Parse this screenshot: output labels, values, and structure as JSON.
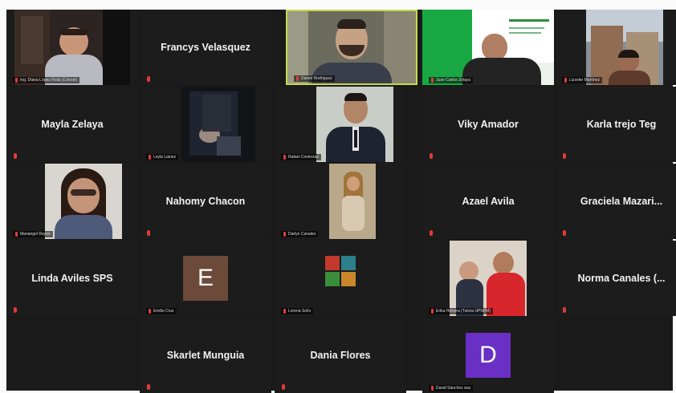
{
  "participants": [
    {
      "display": "label",
      "name": "Ing. Diana López Rolla (Cohost)"
    },
    {
      "display": "name",
      "name": "Francys Velasquez"
    },
    {
      "display": "label",
      "name": "Daniel Rodríguez"
    },
    {
      "display": "label",
      "name": "Juan Carlos Zelaya"
    },
    {
      "display": "label",
      "name": "Lizzette Martínez"
    },
    {
      "display": "name",
      "name": "Mayla Zelaya"
    },
    {
      "display": "label",
      "name": "Leyla Lainez"
    },
    {
      "display": "label",
      "name": "Rafael Contreras"
    },
    {
      "display": "name",
      "name": "Viky Amador"
    },
    {
      "display": "name",
      "name": "Karla trejo Teg"
    },
    {
      "display": "label",
      "name": "Mariangel Reyes"
    },
    {
      "display": "name",
      "name": "Nahomy Chacon"
    },
    {
      "display": "label",
      "name": "Darlyn Canales"
    },
    {
      "display": "name",
      "name": "Azael Avila"
    },
    {
      "display": "name",
      "name": "Graciela  Mazari..."
    },
    {
      "display": "name",
      "name": "Linda Aviles SPS"
    },
    {
      "display": "avatar",
      "name": "Emilio Cruz",
      "initial": "E",
      "color": "#6b4a3a"
    },
    {
      "display": "label",
      "name": "Lorena Solís"
    },
    {
      "display": "label",
      "name": "Erika Herrera (Tutora UPNFM)"
    },
    {
      "display": "name",
      "name": "Norma  Canales (..."
    },
    {
      "display": "name",
      "name": "Skarlet Munguia"
    },
    {
      "display": "name",
      "name": "Dania Flores"
    },
    {
      "display": "avatar",
      "name": "David Sánchez soa",
      "initial": "D",
      "color": "#6a2fc4"
    }
  ],
  "colors": {
    "gallery_bg": "#1a1a1a",
    "tile_bg": "#1c1c1c",
    "active_speaker_border": "#c5d94a",
    "muted_mic": "#e23a3a"
  },
  "icons": {
    "muted": "microphone-muted-icon"
  }
}
